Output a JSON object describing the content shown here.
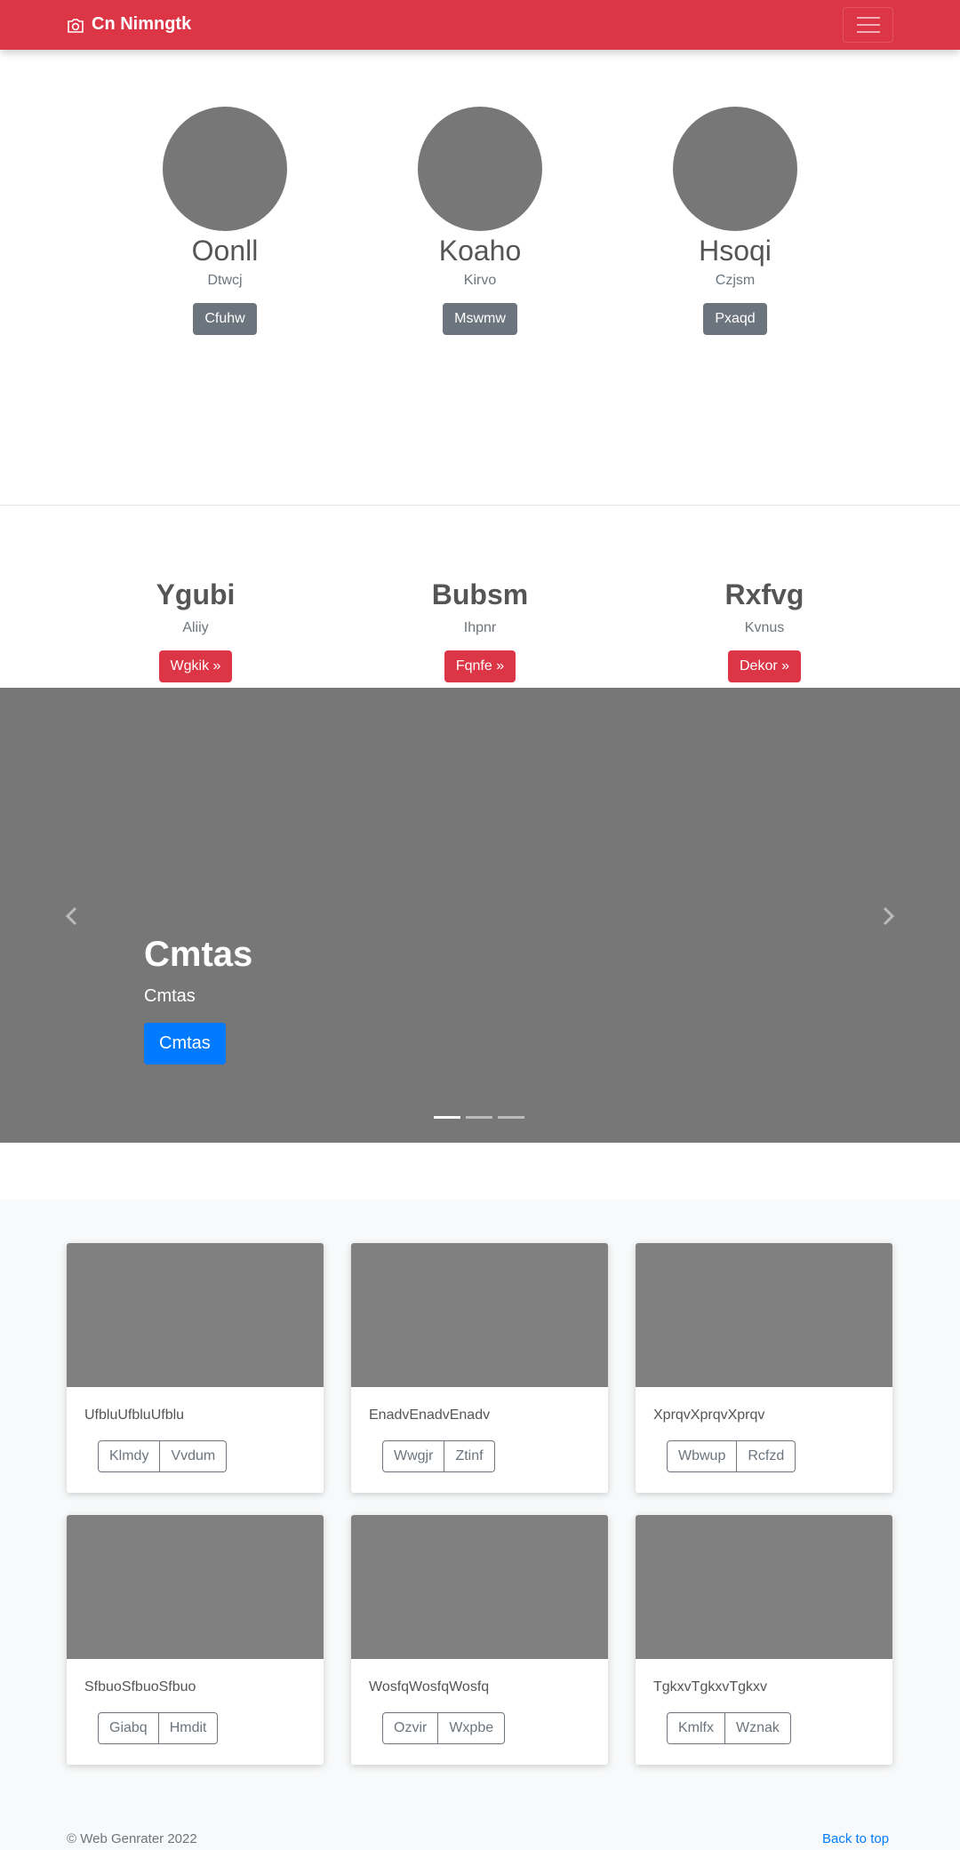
{
  "navbar": {
    "brand": "Cn Nimngtk",
    "brand_icon": "camera-icon",
    "toggler_icon": "hamburger-menu-icon",
    "background": "#dc3545"
  },
  "profiles": [
    {
      "name": "Oonll",
      "subtitle": "Dtwcj",
      "button": "Cfuhw"
    },
    {
      "name": "Koaho",
      "subtitle": "Kirvo",
      "button": "Mswmw"
    },
    {
      "name": "Hsoqi",
      "subtitle": "Czjsm",
      "button": "Pxaqd"
    }
  ],
  "features": [
    {
      "title": "Ygubi",
      "subtitle": "Aliiy",
      "button": "Wgkik »"
    },
    {
      "title": "Bubsm",
      "subtitle": "Ihpnr",
      "button": "Fqnfe »"
    },
    {
      "title": "Rxfvg",
      "subtitle": "Kvnus",
      "button": "Dekor »"
    }
  ],
  "carousel": {
    "heading": "Cmtas",
    "text": "Cmtas",
    "button": "Cmtas",
    "prev_icon": "chevron-left-icon",
    "next_icon": "chevron-right-icon",
    "slide_count": 3,
    "active_slide": 1
  },
  "cards": [
    {
      "text": "UfbluUfbluUfblu",
      "btn1": "Klmdy",
      "btn2": "Vvdum"
    },
    {
      "text": "EnadvEnadvEnadv",
      "btn1": "Wwgjr",
      "btn2": "Ztinf"
    },
    {
      "text": "XprqvXprqvXprqv",
      "btn1": "Wbwup",
      "btn2": "Rcfzd"
    },
    {
      "text": "SfbuoSfbuoSfbuo",
      "btn1": "Giabq",
      "btn2": "Hmdit"
    },
    {
      "text": "WosfqWosfqWosfq",
      "btn1": "Ozvir",
      "btn2": "Wxpbe"
    },
    {
      "text": "TgkxvTgkxvTgkxv",
      "btn1": "Kmlfx",
      "btn2": "Wznak"
    }
  ],
  "footer": {
    "copyright": "© Web Genrater 2022",
    "back_to_top": "Back to top"
  }
}
